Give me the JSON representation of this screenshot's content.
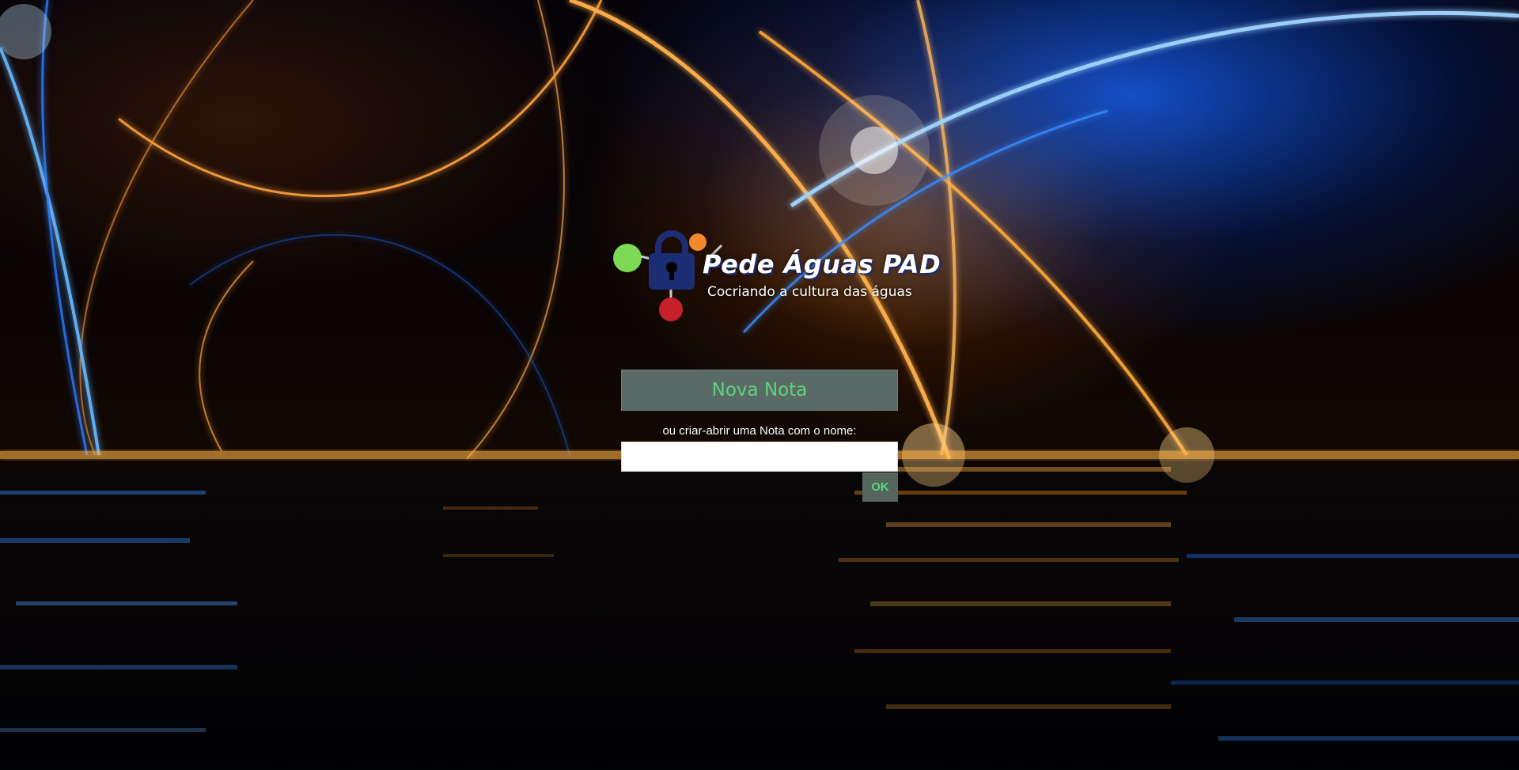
{
  "colors": {
    "button_bg": "#5a6b67",
    "button_text": "#5fd37d",
    "logo_lock": "#1d2d73",
    "logo_green_dot": "#7ed957",
    "logo_orange_dot": "#f08a2c",
    "logo_red_dot": "#c8202a"
  },
  "logo": {
    "title": "Pede Águas PAD",
    "subtitle": "Cocriando a cultura das águas",
    "icons": [
      "padlock-icon",
      "green-dot-icon",
      "orange-dot-icon",
      "red-dot-icon"
    ]
  },
  "form": {
    "new_note_label": "Nova Nota",
    "name_prompt": "ou criar-abrir uma Nota com o nome:",
    "name_value": "",
    "ok_label": "OK"
  }
}
